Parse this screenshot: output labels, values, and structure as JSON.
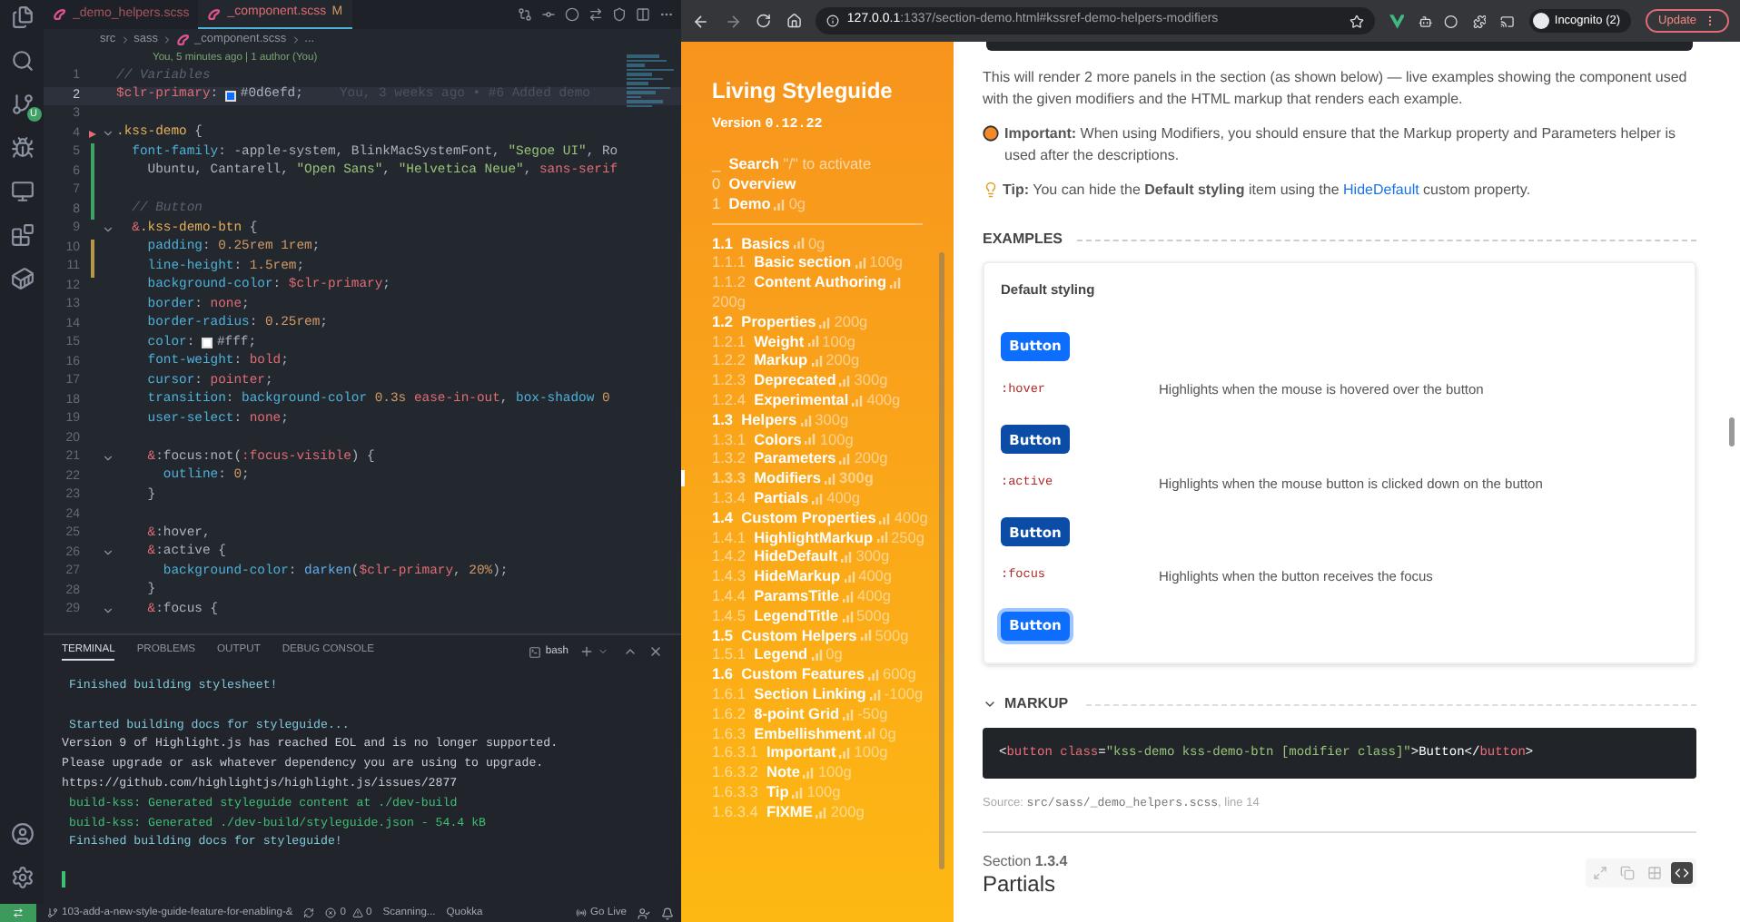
{
  "activity_bar": {
    "badge": "U"
  },
  "editor": {
    "tabs": [
      {
        "label": "_demo_helpers.scss",
        "selected": false
      },
      {
        "label": "_component.scss",
        "badge": "M",
        "selected": true
      }
    ],
    "breadcrumb": [
      "src",
      "sass",
      "_component.scss",
      "..."
    ],
    "codelens": "You, 5 minutes ago | 1 author (You)",
    "lines": [
      {
        "number": "1",
        "kind": "none",
        "foldable": false,
        "current": false,
        "tokens": [
          {
            "text": "// Variables",
            "kind": "comment"
          }
        ]
      },
      {
        "number": "2",
        "kind": "none",
        "foldable": false,
        "current": true,
        "blame": "You, 3 weeks ago • #6 Added demo",
        "tokens": [
          {
            "text": "$clr-primary",
            "kind": "variable"
          },
          {
            "text": ": ",
            "kind": "punct"
          },
          {
            "text": "#0d6efd",
            "kind": "color"
          },
          {
            "text": ";",
            "kind": "punct"
          }
        ]
      },
      {
        "number": "3",
        "kind": "none",
        "foldable": false,
        "current": false
      },
      {
        "number": "4",
        "kind": "deleted",
        "foldable": true,
        "current": false,
        "tokens": [
          {
            "text": ".kss-demo",
            "kind": "selector"
          },
          {
            "text": " {",
            "kind": "punct"
          }
        ]
      },
      {
        "number": "5",
        "kind": "added",
        "foldable": false,
        "current": false,
        "tokens": [
          {
            "text": "  font-family",
            "kind": "property"
          },
          {
            "text": ": ",
            "kind": "punct"
          },
          {
            "text": "-apple-system, BlinkMacSystemFont, ",
            "kind": "plain"
          },
          {
            "text": "\"Segoe UI\"",
            "kind": "string"
          },
          {
            "text": ", Ro",
            "kind": "plain"
          }
        ]
      },
      {
        "number": "6",
        "kind": "added",
        "foldable": false,
        "current": false,
        "tokens": [
          {
            "text": "    Ubuntu, Cantarell, ",
            "kind": "plain"
          },
          {
            "text": "\"Open Sans\"",
            "kind": "string"
          },
          {
            "text": ", ",
            "kind": "plain"
          },
          {
            "text": "\"Helvetica Neue\"",
            "kind": "string"
          },
          {
            "text": ", ",
            "kind": "plain"
          },
          {
            "text": "sans-serif",
            "kind": "value"
          }
        ]
      },
      {
        "number": "7",
        "kind": "added",
        "foldable": false,
        "current": false
      },
      {
        "number": "8",
        "kind": "added",
        "foldable": false,
        "current": false,
        "tokens": [
          {
            "text": "  // Button",
            "kind": "comment"
          }
        ]
      },
      {
        "number": "9",
        "kind": "none",
        "foldable": true,
        "current": false,
        "tokens": [
          {
            "text": "  &",
            "kind": "variable"
          },
          {
            "text": ".kss-demo-btn",
            "kind": "selector"
          },
          {
            "text": " {",
            "kind": "punct"
          }
        ]
      },
      {
        "number": "10",
        "kind": "modified",
        "foldable": false,
        "current": false,
        "tokens": [
          {
            "text": "    padding",
            "kind": "property"
          },
          {
            "text": ": ",
            "kind": "punct"
          },
          {
            "text": "0.25rem 1rem",
            "kind": "number"
          },
          {
            "text": ";",
            "kind": "punct"
          }
        ]
      },
      {
        "number": "11",
        "kind": "modified",
        "foldable": false,
        "current": false,
        "tokens": [
          {
            "text": "    line-height",
            "kind": "property"
          },
          {
            "text": ": ",
            "kind": "punct"
          },
          {
            "text": "1.5rem",
            "kind": "number"
          },
          {
            "text": ";",
            "kind": "punct"
          }
        ]
      },
      {
        "number": "12",
        "kind": "none",
        "foldable": false,
        "current": false,
        "tokens": [
          {
            "text": "    background-color",
            "kind": "property"
          },
          {
            "text": ": ",
            "kind": "punct"
          },
          {
            "text": "$clr-primary",
            "kind": "variable"
          },
          {
            "text": ";",
            "kind": "punct"
          }
        ]
      },
      {
        "number": "13",
        "kind": "none",
        "foldable": false,
        "current": false,
        "tokens": [
          {
            "text": "    border",
            "kind": "property"
          },
          {
            "text": ": ",
            "kind": "punct"
          },
          {
            "text": "none",
            "kind": "value"
          },
          {
            "text": ";",
            "kind": "punct"
          }
        ]
      },
      {
        "number": "14",
        "kind": "none",
        "foldable": false,
        "current": false,
        "tokens": [
          {
            "text": "    border-radius",
            "kind": "property"
          },
          {
            "text": ": ",
            "kind": "punct"
          },
          {
            "text": "0.25rem",
            "kind": "number"
          },
          {
            "text": ";",
            "kind": "punct"
          }
        ]
      },
      {
        "number": "15",
        "kind": "none",
        "foldable": false,
        "current": false,
        "tokens": [
          {
            "text": "    color",
            "kind": "property"
          },
          {
            "text": ": ",
            "kind": "punct"
          },
          {
            "text": "#fff",
            "kind": "color"
          },
          {
            "text": ";",
            "kind": "punct"
          }
        ]
      },
      {
        "number": "16",
        "kind": "none",
        "foldable": false,
        "current": false,
        "tokens": [
          {
            "text": "    font-weight",
            "kind": "property"
          },
          {
            "text": ": ",
            "kind": "punct"
          },
          {
            "text": "bold",
            "kind": "value"
          },
          {
            "text": ";",
            "kind": "punct"
          }
        ]
      },
      {
        "number": "17",
        "kind": "none",
        "foldable": false,
        "current": false,
        "tokens": [
          {
            "text": "    cursor",
            "kind": "property"
          },
          {
            "text": ": ",
            "kind": "punct"
          },
          {
            "text": "pointer",
            "kind": "value"
          },
          {
            "text": ";",
            "kind": "punct"
          }
        ]
      },
      {
        "number": "18",
        "kind": "none",
        "foldable": false,
        "current": false,
        "tokens": [
          {
            "text": "    transition",
            "kind": "property"
          },
          {
            "text": ": ",
            "kind": "punct"
          },
          {
            "text": "background-color ",
            "kind": "property"
          },
          {
            "text": "0.3s ",
            "kind": "number"
          },
          {
            "text": "ease-in-out",
            "kind": "value"
          },
          {
            "text": ", ",
            "kind": "punct"
          },
          {
            "text": "box-shadow ",
            "kind": "property"
          },
          {
            "text": "0",
            "kind": "number"
          }
        ]
      },
      {
        "number": "19",
        "kind": "none",
        "foldable": false,
        "current": false,
        "tokens": [
          {
            "text": "    user-select",
            "kind": "property"
          },
          {
            "text": ": ",
            "kind": "punct"
          },
          {
            "text": "none",
            "kind": "value"
          },
          {
            "text": ";",
            "kind": "punct"
          }
        ]
      },
      {
        "number": "20",
        "kind": "none",
        "foldable": false,
        "current": false
      },
      {
        "number": "21",
        "kind": "none",
        "foldable": true,
        "current": false,
        "tokens": [
          {
            "text": "    &",
            "kind": "variable"
          },
          {
            "text": ":focus:not(",
            "kind": "plain"
          },
          {
            "text": ":focus-visible",
            "kind": "variable"
          },
          {
            "text": ") {",
            "kind": "punct"
          }
        ]
      },
      {
        "number": "22",
        "kind": "none",
        "foldable": false,
        "current": false,
        "tokens": [
          {
            "text": "      outline",
            "kind": "property"
          },
          {
            "text": ": ",
            "kind": "punct"
          },
          {
            "text": "0",
            "kind": "number"
          },
          {
            "text": ";",
            "kind": "punct"
          }
        ]
      },
      {
        "number": "23",
        "kind": "none",
        "foldable": false,
        "current": false,
        "tokens": [
          {
            "text": "    }",
            "kind": "punct"
          }
        ]
      },
      {
        "number": "24",
        "kind": "none",
        "foldable": false,
        "current": false
      },
      {
        "number": "25",
        "kind": "none",
        "foldable": false,
        "current": false,
        "tokens": [
          {
            "text": "    &",
            "kind": "variable"
          },
          {
            "text": ":hover,",
            "kind": "plain"
          }
        ]
      },
      {
        "number": "26",
        "kind": "none",
        "foldable": true,
        "current": false,
        "tokens": [
          {
            "text": "    &",
            "kind": "variable"
          },
          {
            "text": ":active {",
            "kind": "plain"
          }
        ]
      },
      {
        "number": "27",
        "kind": "none",
        "foldable": false,
        "current": false,
        "tokens": [
          {
            "text": "      background-color",
            "kind": "property"
          },
          {
            "text": ": ",
            "kind": "punct"
          },
          {
            "text": "darken",
            "kind": "function"
          },
          {
            "text": "(",
            "kind": "punct"
          },
          {
            "text": "$clr-primary",
            "kind": "variable"
          },
          {
            "text": ", ",
            "kind": "punct"
          },
          {
            "text": "20%",
            "kind": "number"
          },
          {
            "text": ");",
            "kind": "punct"
          }
        ]
      },
      {
        "number": "28",
        "kind": "none",
        "foldable": false,
        "current": false,
        "tokens": [
          {
            "text": "    }",
            "kind": "punct"
          }
        ]
      },
      {
        "number": "29",
        "kind": "none",
        "foldable": true,
        "current": false,
        "tokens": [
          {
            "text": "    &",
            "kind": "variable"
          },
          {
            "text": ":focus {",
            "kind": "plain"
          }
        ]
      }
    ]
  },
  "terminal": {
    "tabs": [
      {
        "label": "TERMINAL",
        "selected": true
      },
      {
        "label": "PROBLEMS",
        "selected": false
      },
      {
        "label": "OUTPUT",
        "selected": false
      },
      {
        "label": "DEBUG CONSOLE",
        "selected": false
      }
    ],
    "shell": "bash",
    "lines": [
      {
        "text": "Finished building stylesheet!",
        "kind": "info",
        "blank_before": false
      },
      {
        "text": "Started building docs for styleguide...",
        "kind": "info",
        "blank_before": true
      },
      {
        "text": "Version 9 of Highlight.js has reached EOL and is no longer supported.",
        "kind": "plain",
        "blank_before": false
      },
      {
        "text": "Please upgrade or ask whatever dependency you are using to upgrade.",
        "kind": "plain",
        "blank_before": false
      },
      {
        "text": "https://github.com/highlightjs/highlight.js/issues/2877",
        "kind": "plain",
        "blank_before": false
      },
      {
        "text": "build-kss: Generated styleguide content at ./dev-build",
        "kind": "success",
        "blank_before": false
      },
      {
        "text": "build-kss: Generated ./dev-build/styleguide.json - 54.4 kB",
        "kind": "success",
        "blank_before": false
      },
      {
        "text": "Finished building docs for styleguide!",
        "kind": "info",
        "blank_before": false
      }
    ]
  },
  "status_bar": {
    "branch": "103-add-a-new-style-guide-feature-for-enabling-&",
    "errors": "0",
    "warnings": "0",
    "task": "Scanning...",
    "quokka": "Quokka",
    "go_live": "Go Live"
  },
  "browser": {
    "url_host": "127.0.0.1",
    "url_path": ":1337/section-demo.html#kssref-demo-helpers-modifiers",
    "profile": "Incognito (2)",
    "update": "Update"
  },
  "sidebar": {
    "title": "Living Styleguide",
    "version_label": "Version",
    "version": "0.12.22",
    "search_key": "_",
    "search_label": "Search",
    "search_hint": "\"/\" to activate",
    "top": [
      {
        "number": "0",
        "title": "Overview"
      },
      {
        "number": "1",
        "title": "Demo",
        "weight": "0g"
      }
    ],
    "tree": [
      {
        "number": "1.1",
        "title": "Basics",
        "weight": "0g",
        "selected": false,
        "children": [
          {
            "number": "1.1.1",
            "title": "Basic section",
            "weight": "100g",
            "selected": false
          },
          {
            "number": "1.1.2",
            "title": "Content Authoring",
            "weight": "200g",
            "selected": false
          }
        ]
      },
      {
        "number": "1.2",
        "title": "Properties",
        "weight": "200g",
        "selected": false,
        "children": [
          {
            "number": "1.2.1",
            "title": "Weight",
            "weight": "100g",
            "selected": false
          },
          {
            "number": "1.2.2",
            "title": "Markup",
            "weight": "200g",
            "selected": false
          },
          {
            "number": "1.2.3",
            "title": "Deprecated",
            "weight": "300g",
            "selected": false
          },
          {
            "number": "1.2.4",
            "title": "Experimental",
            "weight": "400g",
            "selected": false
          }
        ]
      },
      {
        "number": "1.3",
        "title": "Helpers",
        "weight": "300g",
        "selected": false,
        "children": [
          {
            "number": "1.3.1",
            "title": "Colors",
            "weight": "100g",
            "selected": false
          },
          {
            "number": "1.3.2",
            "title": "Parameters",
            "weight": "200g",
            "selected": false
          },
          {
            "number": "1.3.3",
            "title": "Modifiers",
            "weight": "300g",
            "selected": true
          },
          {
            "number": "1.3.4",
            "title": "Partials",
            "weight": "400g",
            "selected": false
          }
        ]
      },
      {
        "number": "1.4",
        "title": "Custom Properties",
        "weight": "400g",
        "selected": false,
        "children": [
          {
            "number": "1.4.1",
            "title": "HighlightMarkup",
            "weight": "250g",
            "selected": false
          },
          {
            "number": "1.4.2",
            "title": "HideDefault",
            "weight": "300g",
            "selected": false
          },
          {
            "number": "1.4.3",
            "title": "HideMarkup",
            "weight": "400g",
            "selected": false
          },
          {
            "number": "1.4.4",
            "title": "ParamsTitle",
            "weight": "400g",
            "selected": false
          },
          {
            "number": "1.4.5",
            "title": "LegendTitle",
            "weight": "500g",
            "selected": false
          }
        ]
      },
      {
        "number": "1.5",
        "title": "Custom Helpers",
        "weight": "500g",
        "selected": false,
        "children": [
          {
            "number": "1.5.1",
            "title": "Legend",
            "weight": "0g",
            "selected": false
          }
        ]
      },
      {
        "number": "1.6",
        "title": "Custom Features",
        "weight": "600g",
        "selected": false,
        "children": [
          {
            "number": "1.6.1",
            "title": "Section Linking",
            "weight": "-100g",
            "selected": false
          },
          {
            "number": "1.6.2",
            "title": "8-point Grid",
            "weight": "-50g",
            "selected": false
          },
          {
            "number": "1.6.3",
            "title": "Embellishment",
            "weight": "0g",
            "selected": false,
            "children": [
              {
                "number": "1.6.3.1",
                "title": "Important",
                "weight": "100g",
                "selected": false
              },
              {
                "number": "1.6.3.2",
                "title": "Note",
                "weight": "100g",
                "selected": false
              },
              {
                "number": "1.6.3.3",
                "title": "Tip",
                "weight": "100g",
                "selected": false
              },
              {
                "number": "1.6.3.4",
                "title": "FIXME",
                "weight": "200g",
                "selected": false
              }
            ]
          }
        ]
      }
    ]
  },
  "content": {
    "intro": "This will render 2 more panels in the section (as shown below) — live examples showing the component used with the given modifiers and the HTML markup that renders each example.",
    "important": "**Important:** When using Modifiers, you should ensure that the Markup property and Parameters helper is used after the descriptions.",
    "tip_before": "**Tip:** You can hide the **Default styling** item using the ",
    "tip_link": "HideDefault",
    "tip_after": " custom property.",
    "examples": {
      "heading": "EXAMPLES",
      "default_label": "Default styling",
      "default_button": {
        "label": "Button",
        "kind": "default"
      },
      "modifiers": [
        {
          "name": ":hover",
          "description": "Highlights when the mouse is hovered over the button",
          "button": {
            "label": "Button",
            "kind": "hover"
          }
        },
        {
          "name": ":active",
          "description": "Highlights when the mouse button is clicked down on the button",
          "button": {
            "label": "Button",
            "kind": "active"
          }
        },
        {
          "name": ":focus",
          "description": "Highlights when the button receives the focus",
          "button": {
            "label": "Button",
            "kind": "focus"
          }
        }
      ]
    },
    "markup": {
      "heading": "MARKUP",
      "expanded": true,
      "tokens": [
        {
          "text": "<",
          "kind": "punct"
        },
        {
          "text": "button",
          "kind": "tag"
        },
        {
          "text": " class",
          "kind": "attr"
        },
        {
          "text": "=",
          "kind": "punct"
        },
        {
          "text": "\"kss-demo kss-demo-btn [modifier class]\"",
          "kind": "string"
        },
        {
          "text": ">Button</",
          "kind": "punct"
        },
        {
          "text": "button",
          "kind": "tag"
        },
        {
          "text": ">",
          "kind": "punct"
        }
      ],
      "source_label": "Source:",
      "source_file": "src/sass/_demo_helpers.scss",
      "source_line": ", line 14"
    },
    "next_section": {
      "label": "Section **1.3.4**",
      "title": "Partials"
    },
    "view_buttons": [
      {
        "kind": "expand",
        "selected": false
      },
      {
        "kind": "copy",
        "selected": false
      },
      {
        "kind": "grid",
        "selected": false
      },
      {
        "kind": "code",
        "selected": true
      }
    ]
  }
}
